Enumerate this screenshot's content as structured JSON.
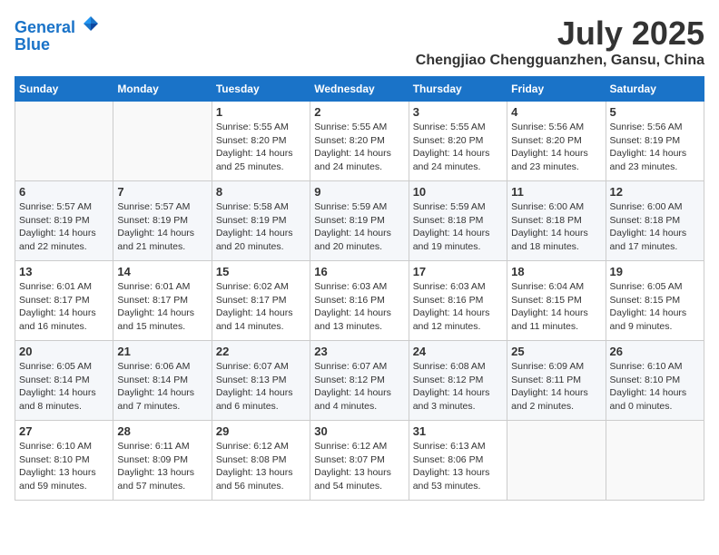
{
  "logo": {
    "line1": "General",
    "line2": "Blue"
  },
  "title": "July 2025",
  "location": "Chengjiao Chengguanzhen, Gansu, China",
  "days_header": [
    "Sunday",
    "Monday",
    "Tuesday",
    "Wednesday",
    "Thursday",
    "Friday",
    "Saturday"
  ],
  "weeks": [
    [
      {
        "day": "",
        "info": ""
      },
      {
        "day": "",
        "info": ""
      },
      {
        "day": "1",
        "info": "Sunrise: 5:55 AM\nSunset: 8:20 PM\nDaylight: 14 hours and 25 minutes."
      },
      {
        "day": "2",
        "info": "Sunrise: 5:55 AM\nSunset: 8:20 PM\nDaylight: 14 hours and 24 minutes."
      },
      {
        "day": "3",
        "info": "Sunrise: 5:55 AM\nSunset: 8:20 PM\nDaylight: 14 hours and 24 minutes."
      },
      {
        "day": "4",
        "info": "Sunrise: 5:56 AM\nSunset: 8:20 PM\nDaylight: 14 hours and 23 minutes."
      },
      {
        "day": "5",
        "info": "Sunrise: 5:56 AM\nSunset: 8:19 PM\nDaylight: 14 hours and 23 minutes."
      }
    ],
    [
      {
        "day": "6",
        "info": "Sunrise: 5:57 AM\nSunset: 8:19 PM\nDaylight: 14 hours and 22 minutes."
      },
      {
        "day": "7",
        "info": "Sunrise: 5:57 AM\nSunset: 8:19 PM\nDaylight: 14 hours and 21 minutes."
      },
      {
        "day": "8",
        "info": "Sunrise: 5:58 AM\nSunset: 8:19 PM\nDaylight: 14 hours and 20 minutes."
      },
      {
        "day": "9",
        "info": "Sunrise: 5:59 AM\nSunset: 8:19 PM\nDaylight: 14 hours and 20 minutes."
      },
      {
        "day": "10",
        "info": "Sunrise: 5:59 AM\nSunset: 8:18 PM\nDaylight: 14 hours and 19 minutes."
      },
      {
        "day": "11",
        "info": "Sunrise: 6:00 AM\nSunset: 8:18 PM\nDaylight: 14 hours and 18 minutes."
      },
      {
        "day": "12",
        "info": "Sunrise: 6:00 AM\nSunset: 8:18 PM\nDaylight: 14 hours and 17 minutes."
      }
    ],
    [
      {
        "day": "13",
        "info": "Sunrise: 6:01 AM\nSunset: 8:17 PM\nDaylight: 14 hours and 16 minutes."
      },
      {
        "day": "14",
        "info": "Sunrise: 6:01 AM\nSunset: 8:17 PM\nDaylight: 14 hours and 15 minutes."
      },
      {
        "day": "15",
        "info": "Sunrise: 6:02 AM\nSunset: 8:17 PM\nDaylight: 14 hours and 14 minutes."
      },
      {
        "day": "16",
        "info": "Sunrise: 6:03 AM\nSunset: 8:16 PM\nDaylight: 14 hours and 13 minutes."
      },
      {
        "day": "17",
        "info": "Sunrise: 6:03 AM\nSunset: 8:16 PM\nDaylight: 14 hours and 12 minutes."
      },
      {
        "day": "18",
        "info": "Sunrise: 6:04 AM\nSunset: 8:15 PM\nDaylight: 14 hours and 11 minutes."
      },
      {
        "day": "19",
        "info": "Sunrise: 6:05 AM\nSunset: 8:15 PM\nDaylight: 14 hours and 9 minutes."
      }
    ],
    [
      {
        "day": "20",
        "info": "Sunrise: 6:05 AM\nSunset: 8:14 PM\nDaylight: 14 hours and 8 minutes."
      },
      {
        "day": "21",
        "info": "Sunrise: 6:06 AM\nSunset: 8:14 PM\nDaylight: 14 hours and 7 minutes."
      },
      {
        "day": "22",
        "info": "Sunrise: 6:07 AM\nSunset: 8:13 PM\nDaylight: 14 hours and 6 minutes."
      },
      {
        "day": "23",
        "info": "Sunrise: 6:07 AM\nSunset: 8:12 PM\nDaylight: 14 hours and 4 minutes."
      },
      {
        "day": "24",
        "info": "Sunrise: 6:08 AM\nSunset: 8:12 PM\nDaylight: 14 hours and 3 minutes."
      },
      {
        "day": "25",
        "info": "Sunrise: 6:09 AM\nSunset: 8:11 PM\nDaylight: 14 hours and 2 minutes."
      },
      {
        "day": "26",
        "info": "Sunrise: 6:10 AM\nSunset: 8:10 PM\nDaylight: 14 hours and 0 minutes."
      }
    ],
    [
      {
        "day": "27",
        "info": "Sunrise: 6:10 AM\nSunset: 8:10 PM\nDaylight: 13 hours and 59 minutes."
      },
      {
        "day": "28",
        "info": "Sunrise: 6:11 AM\nSunset: 8:09 PM\nDaylight: 13 hours and 57 minutes."
      },
      {
        "day": "29",
        "info": "Sunrise: 6:12 AM\nSunset: 8:08 PM\nDaylight: 13 hours and 56 minutes."
      },
      {
        "day": "30",
        "info": "Sunrise: 6:12 AM\nSunset: 8:07 PM\nDaylight: 13 hours and 54 minutes."
      },
      {
        "day": "31",
        "info": "Sunrise: 6:13 AM\nSunset: 8:06 PM\nDaylight: 13 hours and 53 minutes."
      },
      {
        "day": "",
        "info": ""
      },
      {
        "day": "",
        "info": ""
      }
    ]
  ]
}
